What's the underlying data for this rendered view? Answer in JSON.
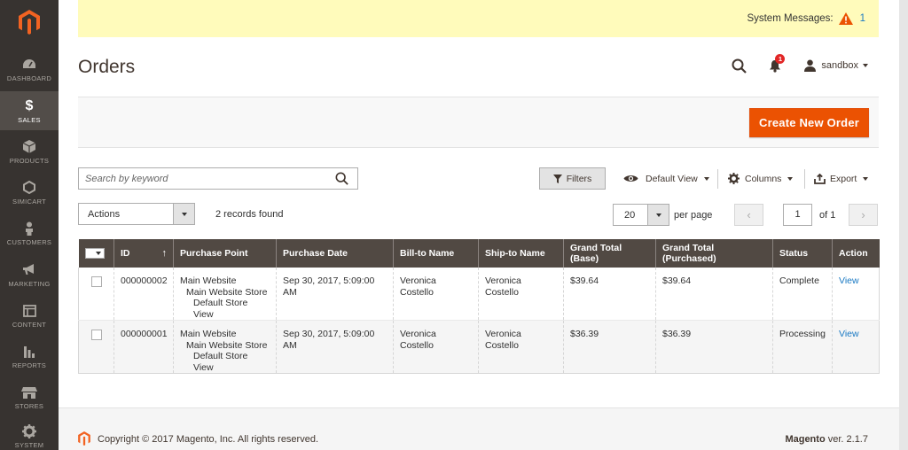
{
  "app": {
    "name": "Magento Admin"
  },
  "sidebar": {
    "items": [
      {
        "id": "dashboard",
        "label": "DASHBOARD",
        "icon": "dashboard-icon",
        "active": false
      },
      {
        "id": "sales",
        "label": "SALES",
        "icon": "dollar-icon",
        "active": true
      },
      {
        "id": "products",
        "label": "PRODUCTS",
        "icon": "cube-icon",
        "active": false
      },
      {
        "id": "simicart",
        "label": "SIMICART",
        "icon": "hexagon-icon",
        "active": false
      },
      {
        "id": "customers",
        "label": "CUSTOMERS",
        "icon": "person-icon",
        "active": false
      },
      {
        "id": "marketing",
        "label": "MARKETING",
        "icon": "megaphone-icon",
        "active": false
      },
      {
        "id": "content",
        "label": "CONTENT",
        "icon": "layout-icon",
        "active": false
      },
      {
        "id": "reports",
        "label": "REPORTS",
        "icon": "bar-chart-icon",
        "active": false
      },
      {
        "id": "stores",
        "label": "STORES",
        "icon": "store-icon",
        "active": false
      },
      {
        "id": "system",
        "label": "SYSTEM",
        "icon": "gear-icon",
        "active": false
      }
    ]
  },
  "system_messages": {
    "label": "System Messages:",
    "count": "1"
  },
  "header": {
    "title": "Orders",
    "user": "sandbox",
    "notifications": "1"
  },
  "toolbar": {
    "create_label": "Create New Order"
  },
  "grid_controls": {
    "search_placeholder": "Search by keyword",
    "filters_label": "Filters",
    "view_label": "Default View",
    "columns_label": "Columns",
    "export_label": "Export",
    "actions_label": "Actions",
    "records_found": "2 records found",
    "per_page_value": "20",
    "per_page_label": "per page",
    "page_value": "1",
    "page_of": "of 1"
  },
  "table": {
    "columns": [
      "ID",
      "Purchase Point",
      "Purchase Date",
      "Bill-to Name",
      "Ship-to Name",
      "Grand Total (Base)",
      "Grand Total (Purchased)",
      "Status",
      "Action"
    ],
    "sort_indicator": "↑",
    "rows": [
      {
        "id": "000000002",
        "purchase_point": [
          "Main Website",
          "Main Website Store",
          "Default Store View"
        ],
        "purchase_date": "Sep 30, 2017, 5:09:00 AM",
        "bill_to": "Veronica Costello",
        "ship_to": "Veronica Costello",
        "total_base": "$39.64",
        "total_purchased": "$39.64",
        "status": "Complete",
        "action": "View"
      },
      {
        "id": "000000001",
        "purchase_point": [
          "Main Website",
          "Main Website Store",
          "Default Store View"
        ],
        "purchase_date": "Sep 30, 2017, 5:09:00 AM",
        "bill_to": "Veronica Costello",
        "ship_to": "Veronica Costello",
        "total_base": "$36.39",
        "total_purchased": "$36.39",
        "status": "Processing",
        "action": "View"
      }
    ]
  },
  "footer": {
    "copyright": "Copyright © 2017 Magento, Inc. All rights reserved.",
    "brand": "Magento",
    "version": "ver. 2.1.7"
  },
  "colors": {
    "accent": "#eb5202",
    "sidebar": "#373330",
    "table_header": "#514943",
    "link": "#1979c3",
    "message_bar": "#fffbbb"
  }
}
